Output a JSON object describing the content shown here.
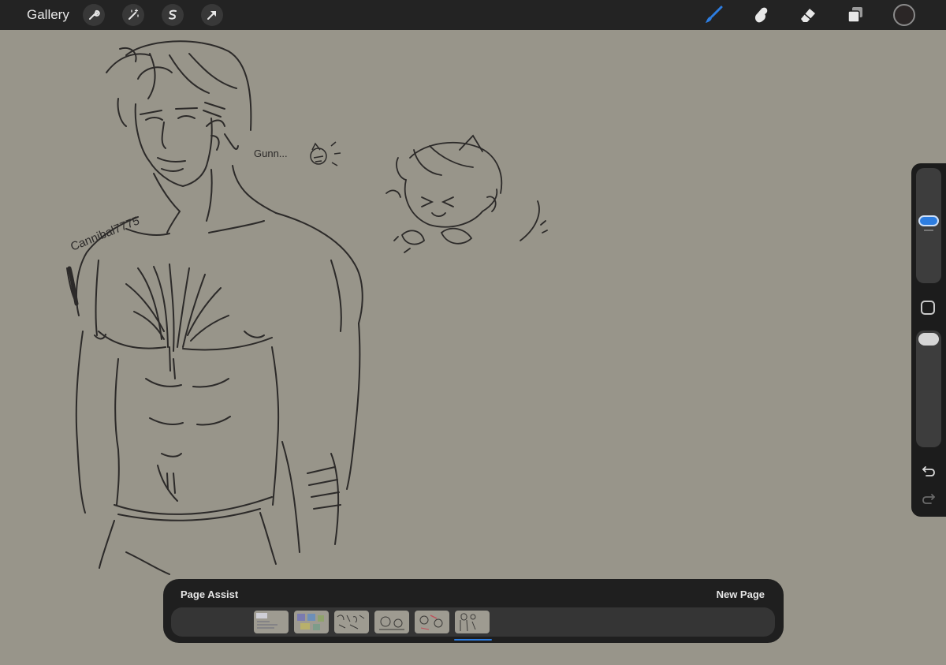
{
  "topbar": {
    "gallery_label": "Gallery",
    "left_tools": [
      "wrench-icon",
      "magic-wand-icon",
      "selection-icon",
      "transform-arrow-icon"
    ],
    "right_tools": [
      "brush-icon",
      "smudge-icon",
      "eraser-icon",
      "layers-icon"
    ],
    "active_tool": "brush-icon",
    "accent_color": "#2d7de0",
    "current_color": "#2b2626"
  },
  "canvas": {
    "background_color": "#98958a",
    "signature_text": "Cannibal7775",
    "speech_text": "Gunn..."
  },
  "sidebar": {
    "brush_size_level": 0.55,
    "opacity_level": 1.0,
    "icons": [
      "modify-icon",
      "undo-icon",
      "redo-icon"
    ]
  },
  "page_assist": {
    "title": "Page Assist",
    "new_page_label": "New Page",
    "page_count": 6,
    "active_page": 6
  }
}
